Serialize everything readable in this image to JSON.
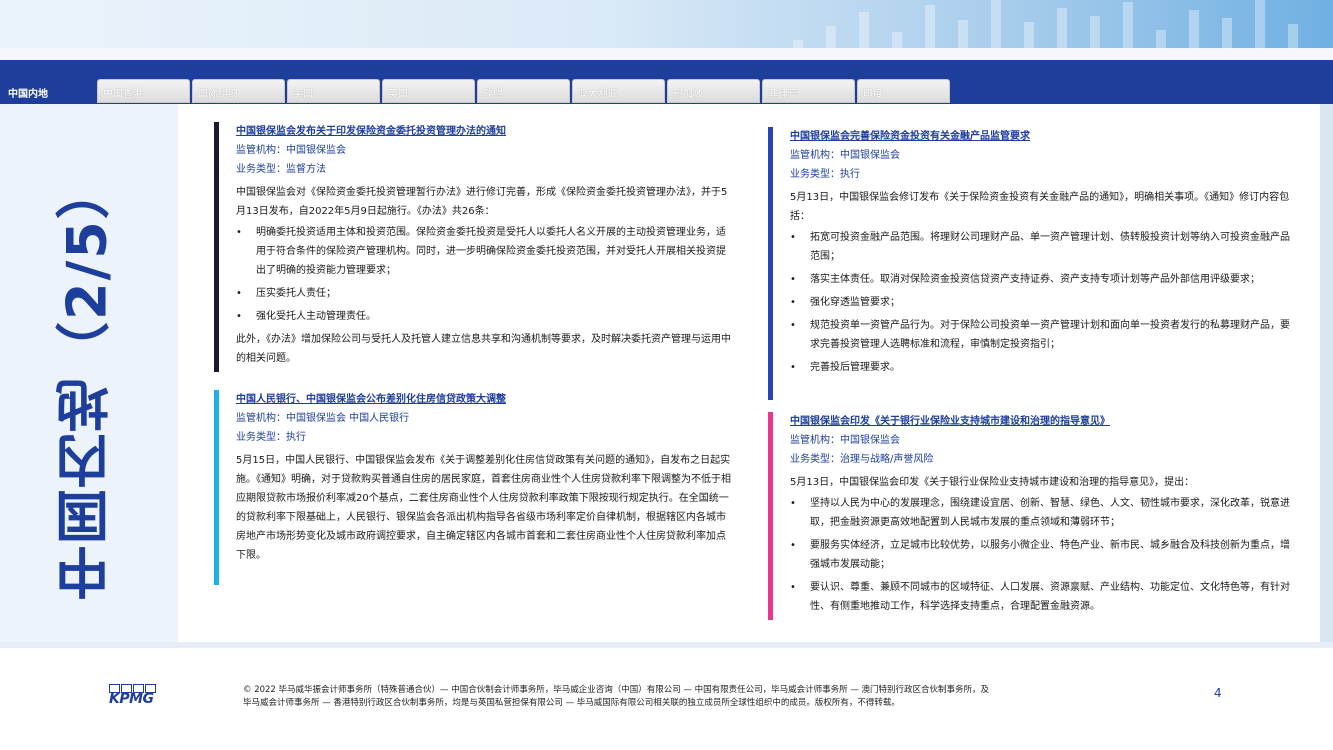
{
  "tabs": [
    {
      "label": "中国内地",
      "active": true
    },
    {
      "label": "中国香港"
    },
    {
      "label": "国际组织"
    },
    {
      "label": "美国"
    },
    {
      "label": "英国"
    },
    {
      "label": "欧盟"
    },
    {
      "label": "澳大利亚"
    },
    {
      "label": "新加坡"
    },
    {
      "label": "菲律宾"
    },
    {
      "label": "印度"
    }
  ],
  "side_title": "中国内地（2/5）",
  "meta_labels": {
    "regulator": "监管机构：",
    "type": "业务类型："
  },
  "articles": [
    {
      "title": "中国银保监会发布关于印发保险资金委托投资管理办法的通知",
      "regulator": "中国银保监会",
      "type": "监督方法",
      "accent": "#1a1a2e",
      "intro": "中国银保监会对《保险资金委托投资管理暂行办法》进行修订完善，形成《保险资金委托投资管理办法》，并于5月13日发布，自2022年5月9日起施行。《办法》共26条：",
      "bullets": [
        "明确委托投资适用主体和投资范围。保险资金委托投资是受托人以委托人名义开展的主动投资管理业务，适用于符合条件的保险资产管理机构。同时，进一步明确保险资金委托投资范围，并对受托人开展相关投资提出了明确的投资能力管理要求；",
        "压实委托人责任；",
        "强化受托人主动管理责任。"
      ],
      "outro": "此外，《办法》增加保险公司与受托人及托管人建立信息共享和沟通机制等要求，及时解决委托资产管理与运用中的相关问题。"
    },
    {
      "title": "中国人民银行、中国银保监会公布差别化住房信贷政策大调整",
      "regulator": "中国银保监会 中国人民银行",
      "type": "执行",
      "accent": "#1ab0e8",
      "intro": "5月15日，中国人民银行、中国银保监会发布《关于调整差别化住房信贷政策有关问题的通知》，自发布之日起实施。《通知》明确，对于贷款购买普通自住房的居民家庭，首套住房商业性个人住房贷款利率下限调整为不低于相应期限贷款市场报价利率减20个基点，二套住房商业性个人住房贷款利率政策下限按现行规定执行。在全国统一的贷款利率下限基础上，人民银行、银保监会各派出机构指导各省级市场利率定价自律机制，根据辖区内各城市房地产市场形势变化及城市政府调控要求，自主确定辖区内各城市首套和二套住房商业性个人住房贷款利率加点下限。",
      "bullets": [],
      "outro": ""
    },
    {
      "title": "中国银保监会完善保险资金投资有关金融产品监管要求",
      "regulator": "中国银保监会",
      "type": "执行",
      "accent": "#2446b8",
      "intro": "5月13日，中国银保监会修订发布《关于保险资金投资有关金融产品的通知》，明确相关事项。《通知》修订内容包括：",
      "bullets": [
        "拓宽可投资金融产品范围。将理财公司理财产品、单一资产管理计划、债转股投资计划等纳入可投资金融产品范围；",
        "落实主体责任。取消对保险资金投资信贷资产支持证券、资产支持专项计划等产品外部信用评级要求；",
        "强化穿透监管要求；",
        "规范投资单一资管产品行为。对于保险公司投资单一资产管理计划和面向单一投资者发行的私募理财产品，要求完善投资管理人选聘标准和流程，审慎制定投资指引；",
        "完善投后管理要求。"
      ],
      "outro": ""
    },
    {
      "title": "中国银保监会印发《关于银行业保险业支持城市建设和治理的指导意见》",
      "regulator": "中国银保监会",
      "type": "治理与战略/声誉风险",
      "accent": "#e8368f",
      "intro": "5月13日，中国银保监会印发《关于银行业保险业支持城市建设和治理的指导意见》，提出：",
      "bullets": [
        "坚持以人民为中心的发展理念，围绕建设宜居、创新、智慧、绿色、人文、韧性城市要求，深化改革，锐意进取，把金融资源更高效地配置到人民城市发展的重点领域和薄弱环节；",
        "要服务实体经济，立足城市比较优势，以服务小微企业、特色产业、新市民、城乡融合及科技创新为重点，增强城市发展动能；",
        "要认识、尊重、兼顾不同城市的区域特征、人口发展、资源禀赋、产业结构、功能定位、文化特色等，有针对性、有侧重地推动工作，科学选择支持重点，合理配置金融资源。"
      ],
      "outro": ""
    }
  ],
  "footer": {
    "logo": "KPMG",
    "line1": "© 2022 毕马威华振会计师事务所（特殊普通合伙）— 中国合伙制会计师事务所，毕马威企业咨询（中国）有限公司 — 中国有限责任公司，毕马威会计师事务所 — 澳门特别行政区合伙制事务所，及",
    "line2": "毕马威会计师事务所 — 香港特别行政区合伙制事务所，均是与英国私营担保有限公司 — 毕马威国际有限公司相关联的独立成员所全球性组织中的成员。版权所有，不得转载。",
    "page": "4"
  }
}
